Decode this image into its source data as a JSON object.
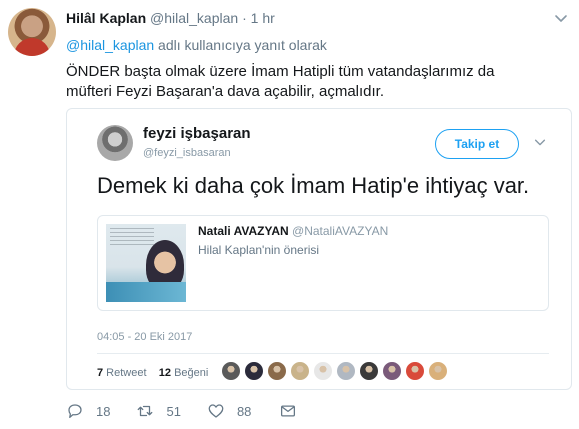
{
  "tweet": {
    "author_name": "Hilâl Kaplan",
    "author_handle": "@hilal_kaplan",
    "dot": "·",
    "time": "1 hr",
    "reply_mention": "@hilal_kaplan",
    "reply_suffix": " adlı kullanıcıya yanıt olarak",
    "text": "ÖNDER başta olmak üzere İmam Hatipli tüm vatandaşlarımız da müfteri Feyzi Başaran'a dava açabilir, açmalıdır.",
    "reply_count": "18",
    "retweet_count": "51",
    "like_count": "88"
  },
  "embedded": {
    "name": "feyzi işbaşaran",
    "handle": "@feyzi_isbasaran",
    "follow_label": "Takip et",
    "text": "Demek ki daha çok İmam Hatip'e ihtiyaç var.",
    "quoted": {
      "name": "Natali AVAZYAN",
      "handle": "@NataliAVAZYAN",
      "text": "Hilal Kaplan'nin önerisi"
    },
    "date": "04:05 - 20 Eki 2017",
    "retweets_num": "7",
    "retweets_label": " Retweet",
    "likes_num": "12",
    "likes_label": " Beğeni"
  },
  "colors": {
    "accent": "#1da1f2",
    "link": "#1b95e0",
    "muted": "#657786"
  },
  "icons": {
    "reply": "reply-icon",
    "retweet": "retweet-icon",
    "like": "heart-icon",
    "dm": "envelope-icon",
    "caret": "chevron-down-icon"
  },
  "liker_avatars": [
    "#5a5a5a",
    "#2b2b3b",
    "#8a6a4a",
    "#c9b38a",
    "#e7e7e7",
    "#b0b8c2",
    "#3a3a3a",
    "#7a5a7a",
    "#d94a3a",
    "#d9b07a"
  ]
}
